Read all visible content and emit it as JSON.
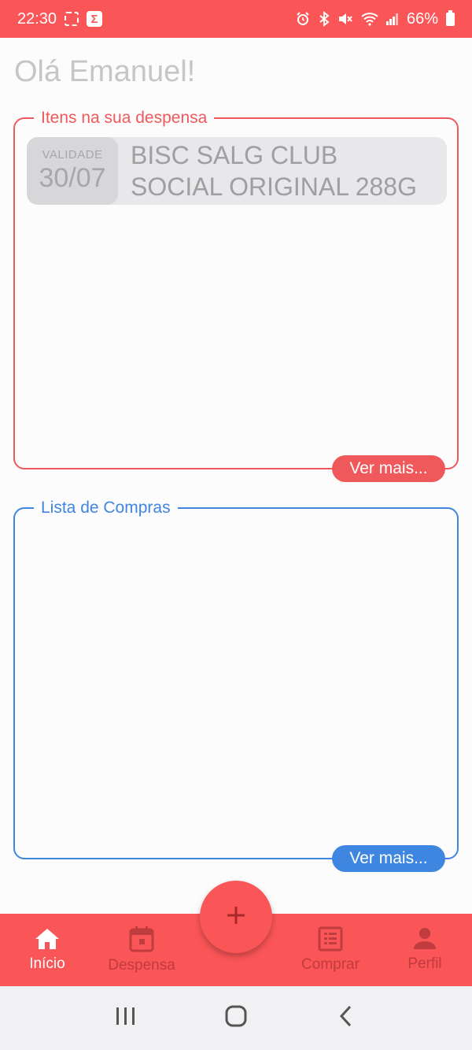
{
  "status_bar": {
    "time": "22:30",
    "battery": "66%"
  },
  "greeting": "Olá Emanuel!",
  "pantry": {
    "title": "Itens na sua despensa",
    "items": [
      {
        "validity_label": "VALIDADE",
        "validity_date": "30/07",
        "name": "BISC SALG CLUB SOCIAL ORIGINAL 288G"
      }
    ],
    "more_label": "Ver mais..."
  },
  "shopping_list": {
    "title": "Lista de Compras",
    "more_label": "Ver mais..."
  },
  "bottom_nav": {
    "items": [
      {
        "label": "Início",
        "icon": "home-icon",
        "active": true
      },
      {
        "label": "Despensa",
        "icon": "calendar-icon",
        "active": false
      },
      {
        "label": "Comprar",
        "icon": "list-icon",
        "active": false
      },
      {
        "label": "Perfil",
        "icon": "person-icon",
        "active": false
      }
    ],
    "fab_icon": "plus-icon"
  },
  "colors": {
    "primary": "#fa5557",
    "pantry_accent": "#f0595b",
    "shopping_accent": "#3f86e0"
  }
}
